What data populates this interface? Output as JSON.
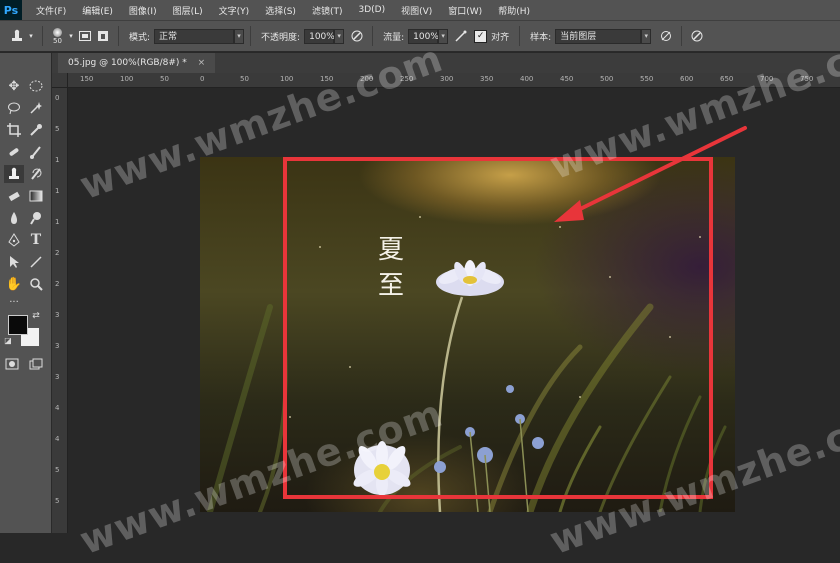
{
  "app": {
    "logo": "Ps"
  },
  "menu": [
    "文件(F)",
    "编辑(E)",
    "图像(I)",
    "图层(L)",
    "文字(Y)",
    "选择(S)",
    "滤镜(T)",
    "3D(D)",
    "视图(V)",
    "窗口(W)",
    "帮助(H)"
  ],
  "options": {
    "brush_size": "50",
    "mode_label": "模式:",
    "mode_value": "正常",
    "opacity_label": "不透明度:",
    "opacity_value": "100%",
    "flow_label": "流量:",
    "flow_value": "100%",
    "align_label": "对齐",
    "align_checked": true,
    "sample_label": "样本:",
    "sample_value": "当前图层"
  },
  "document": {
    "tab_title": "05.jpg @ 100%(RGB/8#)",
    "modified_marker": "*",
    "close_glyph": "×"
  },
  "ruler_h": [
    "150",
    "100",
    "50",
    "0",
    "50",
    "100",
    "150",
    "200",
    "250",
    "300",
    "350",
    "400",
    "450",
    "500",
    "550",
    "600",
    "650",
    "700",
    "750"
  ],
  "ruler_v": [
    "0",
    "5",
    "1",
    "1",
    "1",
    "2",
    "2",
    "3",
    "3",
    "3",
    "4",
    "4",
    "5",
    "5"
  ],
  "image_text": [
    "夏",
    "至"
  ],
  "watermark": "www.wmzhe.com",
  "colors": {
    "selection": "#e8353a",
    "arrow": "#e8353a",
    "foreground": "#0a0a0a",
    "background": "#f2f2f2",
    "accent": "#31a8ff"
  },
  "icons": [
    "stamp-icon",
    "brush-preset-icon",
    "clone-source-icon",
    "aligned-icon",
    "pressure-opacity-icon",
    "airbrush-icon",
    "pressure-size-icon"
  ]
}
